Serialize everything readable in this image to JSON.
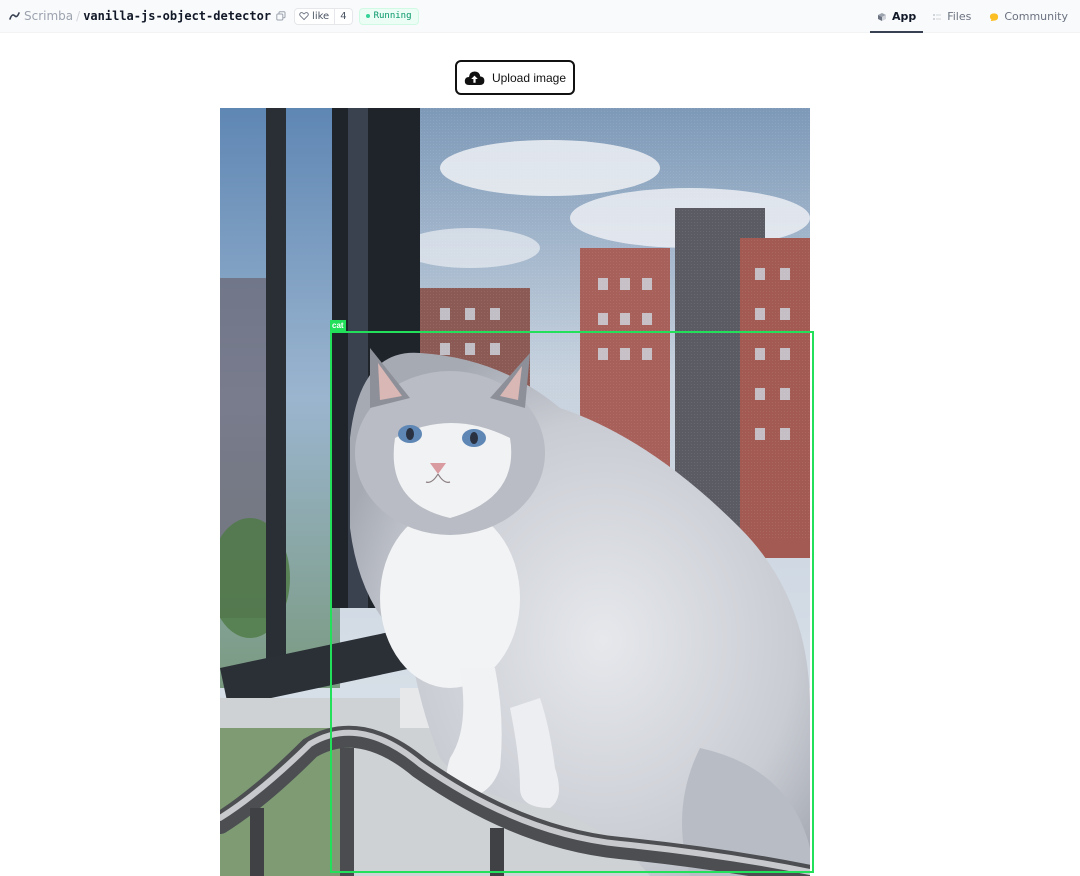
{
  "header": {
    "org": "Scrimba",
    "separator": "/",
    "repo": "vanilla-js-object-detector",
    "like_label": "like",
    "like_count": "4",
    "status": "Running",
    "tabs": [
      {
        "label": "App",
        "icon": "app-icon",
        "active": true
      },
      {
        "label": "Files",
        "icon": "files-icon",
        "active": false
      },
      {
        "label": "Community",
        "icon": "community-icon",
        "active": false
      }
    ]
  },
  "main": {
    "upload_label": "Upload image",
    "upload_icon": "cloud-upload-icon",
    "detections": [
      {
        "label": "cat"
      }
    ]
  },
  "colors": {
    "detection_box": "#22e05a",
    "status_green": "#059669",
    "community_icon": "#fbbf24"
  }
}
